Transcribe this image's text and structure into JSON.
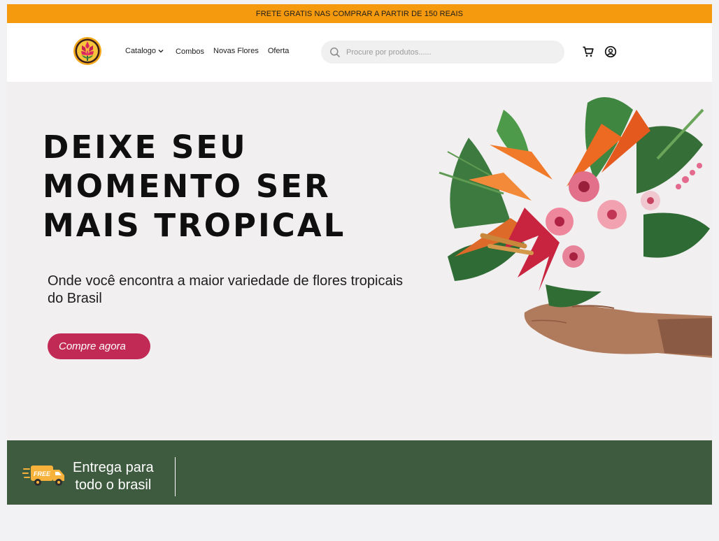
{
  "promo_bar": {
    "text": "FRETE GRATIS NAS COMPRAR A PARTIR DE 150 REAIS"
  },
  "header": {
    "nav": [
      {
        "label": "Catalogo",
        "has_dropdown": true
      },
      {
        "label": "Combos"
      },
      {
        "label": "Novas Flores"
      },
      {
        "label": "Oferta"
      }
    ],
    "search": {
      "placeholder": "Procure por produtos......",
      "value": ""
    },
    "icons": [
      "search-icon",
      "cart-icon",
      "user-account-icon"
    ]
  },
  "hero": {
    "title_lines": [
      "DEIXE SEU",
      "MOMENTO SER",
      "MAIS TROPICAL"
    ],
    "subtitle": "Onde você encontra a maior variedade de flores tropicais do Brasil",
    "cta_label": "Compre agora"
  },
  "footer_band": {
    "badge_text": "FREE",
    "delivery_lines": [
      "Entrega para",
      "todo o brasil"
    ]
  },
  "colors": {
    "promo": "#f59a0f",
    "cta": "#c12a55",
    "band": "#3e5a3f",
    "hero_bg": "#f1eff0",
    "truck": "#f6b23a"
  }
}
